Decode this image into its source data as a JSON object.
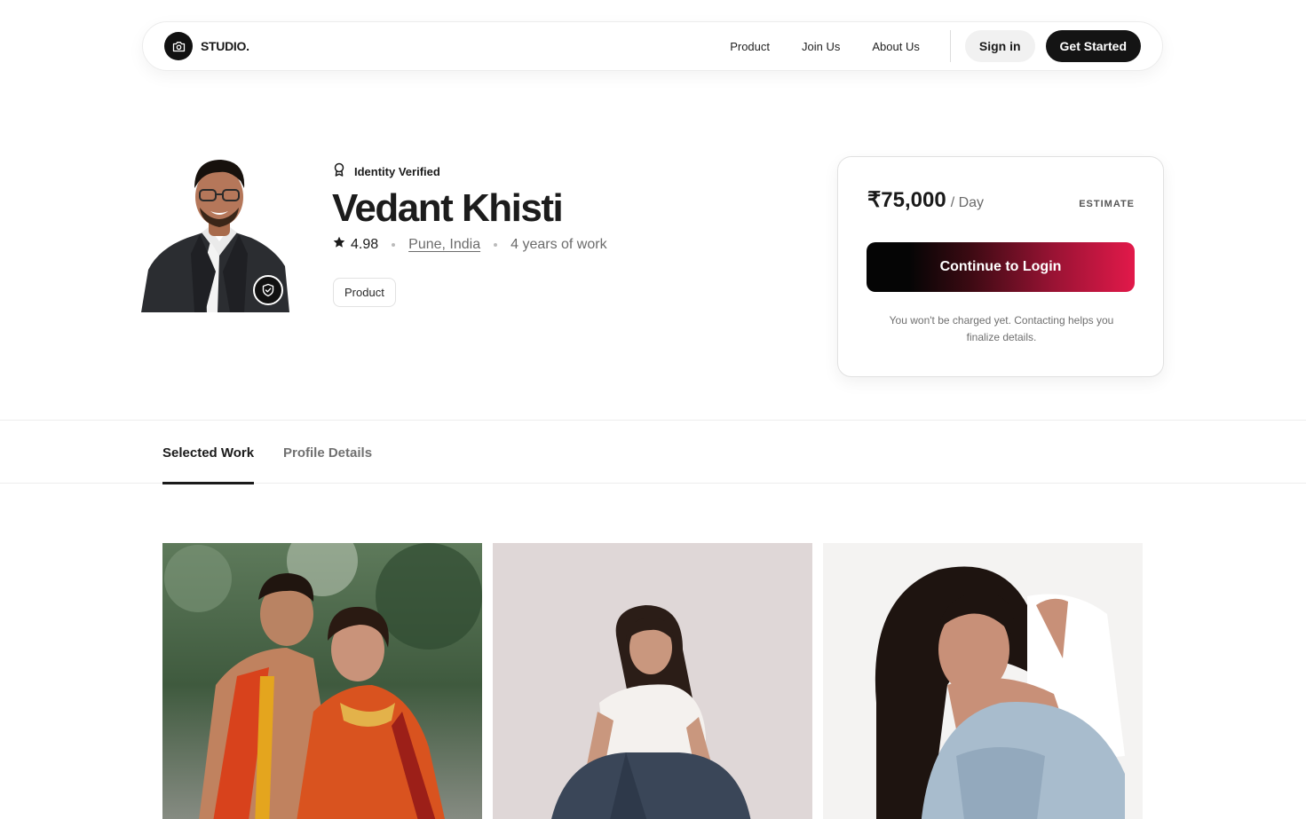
{
  "brand": {
    "name": "STUDIO.",
    "logo_icon": "camera-icon"
  },
  "nav": {
    "links": [
      "Product",
      "Join Us",
      "About Us"
    ],
    "sign_in": "Sign in",
    "get_started": "Get Started"
  },
  "profile": {
    "verified_label": "Identity Verified",
    "verified_icon": "award-icon",
    "name": "Vedant Khisti",
    "rating": "4.98",
    "location": "Pune, India",
    "experience": "4 years of work",
    "tags": [
      "Product"
    ]
  },
  "pricing": {
    "amount": "₹75,000",
    "unit": "/ Day",
    "badge": "ESTIMATE",
    "cta": "Continue to Login",
    "note": "You won't be charged yet. Contacting helps you finalize details."
  },
  "tabs": [
    "Selected Work",
    "Profile Details"
  ],
  "colors": {
    "primary_dark": "#141414",
    "cta_gradient_end": "#e2194a",
    "muted_text": "#6b6b6b"
  }
}
